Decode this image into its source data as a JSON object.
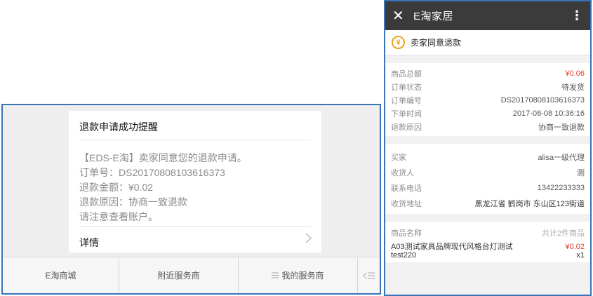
{
  "wechat": {
    "card": {
      "title": "退款申请成功提醒",
      "lines": [
        "【EDS-E淘】卖家同意您的退款申请。",
        "订单号：DS20170808103616373",
        "退款金额：¥0.02",
        "退款原因：协商一致退款",
        "请注意查看账户。"
      ],
      "detail_label": "详情",
      "chevron_icon": "chevron-right-icon"
    },
    "menu": {
      "item1": "E淘商城",
      "item2": "附近服务商",
      "item3": "我的服务商",
      "item3_icon": "menu-list-icon",
      "item4_icon": "keyboard-toggle-icon"
    }
  },
  "order": {
    "appbar": {
      "close_icon": "close-icon",
      "title": "E淘家居",
      "more_icon": "more-vertical-icon"
    },
    "status": {
      "icon": "yen-refund-icon",
      "text": "卖家同意退款"
    },
    "summary": [
      {
        "label": "商品总额",
        "value": "¥0.06"
      },
      {
        "label": "订单状态",
        "value": "待发货"
      },
      {
        "label": "订单编号",
        "value": "DS20170808103616373"
      },
      {
        "label": "下单时间",
        "value": "2017-08-08 10:36:16"
      },
      {
        "label": "退款原因",
        "value": "协商一致退款"
      }
    ],
    "buyer": [
      {
        "label": "买家",
        "value": "alisa一级代理"
      },
      {
        "label": "收货人",
        "value": "测"
      },
      {
        "label": "联系电话",
        "value": "13422233333"
      },
      {
        "label": "收货地址",
        "value": "黑龙江省 鹤岗市 东山区123街道"
      }
    ],
    "goods": {
      "header_label": "商品名称",
      "header_value": "共计2件商品",
      "item_name": "A03测试家具品牌现代风格台灯测试",
      "item_sku": "test220",
      "item_price": "¥0.02",
      "item_qty": "x1"
    },
    "colors": {
      "price_red": "#e23b2e",
      "status_orange": "#f2a01e",
      "appbar": "#3b3b3b",
      "frame_blue": "#3a73b8"
    }
  }
}
